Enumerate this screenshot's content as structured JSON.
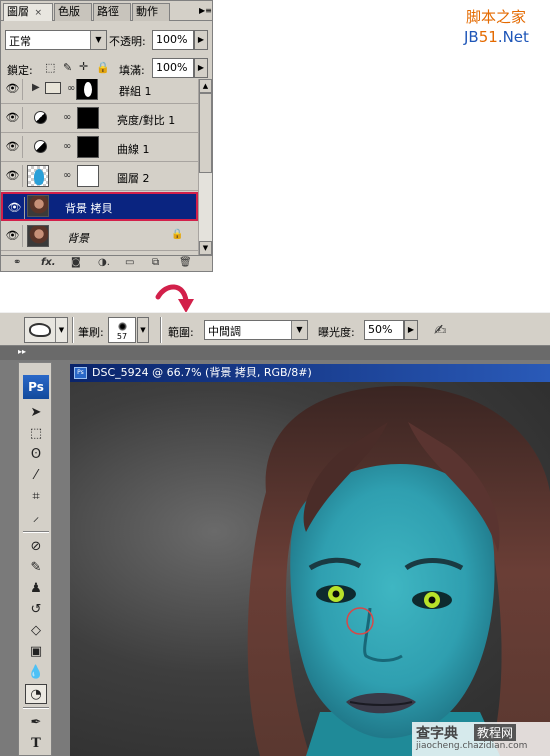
{
  "watermark": {
    "line1": "脚本之家",
    "line2_prefix": "JB",
    "line2_highlight": "51",
    "line2_suffix": ".Net"
  },
  "layers_panel": {
    "tabs": [
      {
        "label": "圖層",
        "close": "×"
      },
      {
        "label": "色版"
      },
      {
        "label": "路徑"
      },
      {
        "label": "動作"
      }
    ],
    "blend_mode": "正常",
    "opacity_label": "不透明:",
    "opacity_value": "100%",
    "lock_label": "鎖定:",
    "fill_label": "填滿:",
    "fill_value": "100%",
    "layers": [
      {
        "name": "群組 1",
        "type": "group"
      },
      {
        "name": "亮度/對比 1",
        "type": "adjustment"
      },
      {
        "name": "曲線 1",
        "type": "adjustment"
      },
      {
        "name": "圖層 2",
        "type": "pixel"
      },
      {
        "name": "背景 拷貝",
        "type": "pixel",
        "selected": true
      },
      {
        "name": "背景",
        "type": "background",
        "locked": true
      }
    ]
  },
  "options_bar": {
    "brush_label": "筆刷:",
    "brush_size": "57",
    "range_label": "範圍:",
    "range_value": "中間調",
    "exposure_label": "曝光度:",
    "exposure_value": "50%"
  },
  "document": {
    "title": "DSC_5924 @ 66.7% (背景 拷貝, RGB/8#)"
  },
  "toolbox": {
    "logo": "Ps",
    "tools": [
      "move-icon",
      "marquee-icon",
      "lasso-icon",
      "magic-wand-icon",
      "crop-icon",
      "eyedropper-icon",
      "healing-brush-icon",
      "brush-icon",
      "clone-stamp-icon",
      "history-brush-icon",
      "eraser-icon",
      "gradient-icon",
      "blur-icon",
      "dodge-icon",
      "pen-icon",
      "type-icon"
    ],
    "active_tool": "dodge-icon"
  },
  "footer_watermark": {
    "brand": "查字典",
    "boxed": "教程网",
    "site": "jiaocheng.chazidian.com"
  },
  "colors": {
    "selected_layer_bg": "#0a2480",
    "selected_layer_border": "#d2204a",
    "title_bar": "#0a246a",
    "skin_teal": "#35a7b7",
    "arrow_red": "#d2204a"
  }
}
